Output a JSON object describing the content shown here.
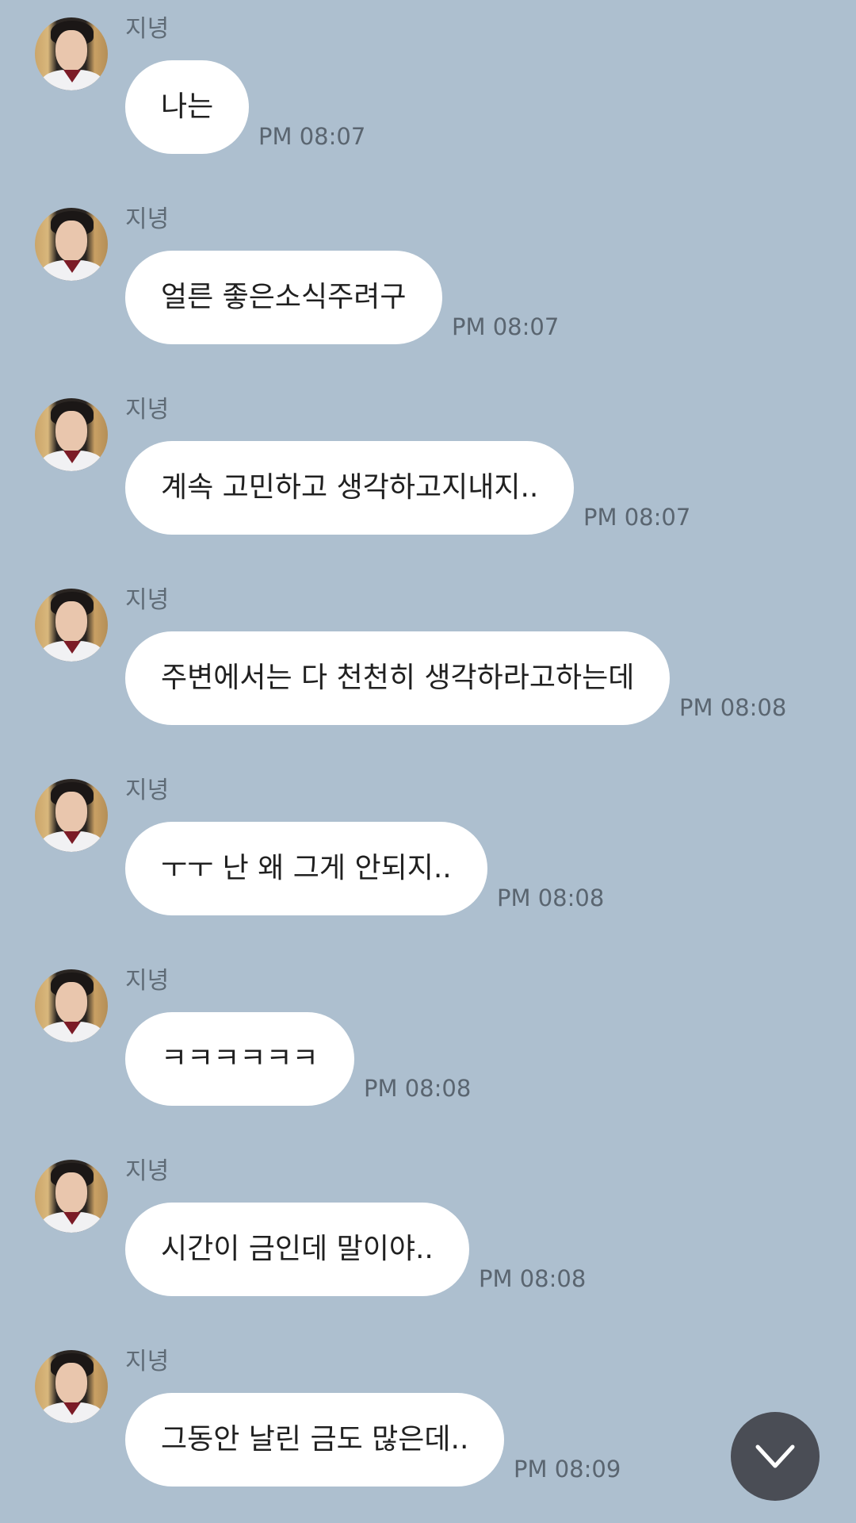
{
  "messages": [
    {
      "sender": "지녕",
      "text": "나는",
      "time": "PM 08:07"
    },
    {
      "sender": "지녕",
      "text": "얼른 좋은소식주려구",
      "time": "PM 08:07"
    },
    {
      "sender": "지녕",
      "text": "계속 고민하고 생각하고지내지..",
      "time": "PM 08:07"
    },
    {
      "sender": "지녕",
      "text": "주변에서는 다 천천히 생각하라고하는데",
      "time": "PM 08:08"
    },
    {
      "sender": "지녕",
      "text": "ㅜㅜ 난 왜 그게 안되지..",
      "time": "PM 08:08"
    },
    {
      "sender": "지녕",
      "text": "ㅋㅋㅋㅋㅋㅋ",
      "time": "PM 08:08"
    },
    {
      "sender": "지녕",
      "text": "시간이 금인데 말이야..",
      "time": "PM 08:08"
    },
    {
      "sender": "지녕",
      "text": "그동안 날린 금도 많은데..",
      "time": "PM 08:09"
    }
  ],
  "scroll_button": {
    "icon": "chevron-down-icon"
  },
  "colors": {
    "background": "#adbfcf",
    "bubble": "#ffffff",
    "scroll_button": "#4a4d55"
  }
}
